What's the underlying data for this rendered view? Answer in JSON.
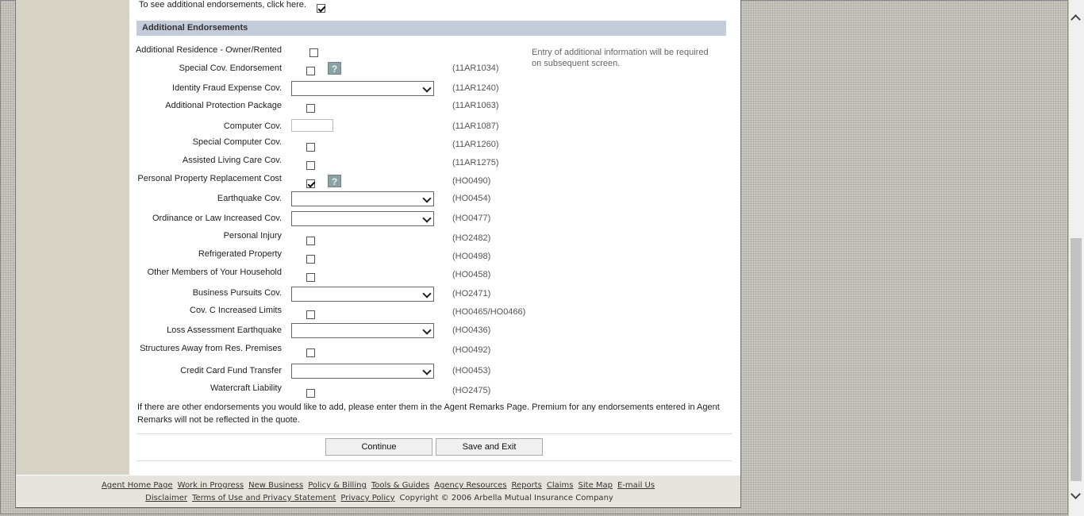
{
  "intro_text": "To see additional endorsements, click here.",
  "section_title": "Additional Endorsements",
  "note": "Entry of additional information will be required on subsequent screen.",
  "rows": [
    {
      "label": "Additional Residence - Owner/Rented",
      "code": "",
      "control": "checkbox",
      "checked": false
    },
    {
      "label": "Special Cov. Endorsement",
      "code": "(11AR1034)",
      "control": "checkbox",
      "checked": false,
      "help": "?"
    },
    {
      "label": "Identity Fraud Expense Cov.",
      "code": "(11AR1240)",
      "control": "select",
      "value": ""
    },
    {
      "label": "Additional Protection Package",
      "code": "(11AR1063)",
      "control": "checkbox",
      "checked": false
    },
    {
      "label": "Computer Cov.",
      "code": "(11AR1087)",
      "control": "text",
      "value": ""
    },
    {
      "label": "Special Computer Cov.",
      "code": "(11AR1260)",
      "control": "checkbox",
      "checked": false
    },
    {
      "label": "Assisted Living Care Cov.",
      "code": "(11AR1275)",
      "control": "checkbox",
      "checked": false
    },
    {
      "label": "Personal Property Replacement Cost",
      "code": "(HO0490)",
      "control": "checkbox",
      "checked": true,
      "help": "?"
    },
    {
      "label": "Earthquake Cov.",
      "code": "(HO0454)",
      "control": "select",
      "value": ""
    },
    {
      "label": "Ordinance or Law Increased Cov.",
      "code": "(HO0477)",
      "control": "select",
      "value": ""
    },
    {
      "label": "Personal Injury",
      "code": "(HO2482)",
      "control": "checkbox",
      "checked": false
    },
    {
      "label": "Refrigerated Property",
      "code": "(HO0498)",
      "control": "checkbox",
      "checked": false
    },
    {
      "label": "Other Members of Your Household",
      "code": "(HO0458)",
      "control": "checkbox",
      "checked": false
    },
    {
      "label": "Business Pursuits Cov.",
      "code": "(HO2471)",
      "control": "select",
      "value": ""
    },
    {
      "label": "Cov. C Increased Limits",
      "code": "(HO0465/HO0466)",
      "control": "checkbox",
      "checked": false
    },
    {
      "label": "Loss Assessment Earthquake",
      "code": "(HO0436)",
      "control": "select",
      "value": ""
    },
    {
      "label": "Structures Away from Res. Premises",
      "code": "(HO0492)",
      "control": "checkbox",
      "checked": false
    },
    {
      "label": "Credit Card Fund Transfer",
      "code": "(HO0453)",
      "control": "select",
      "value": ""
    },
    {
      "label": "Watercraft Liability",
      "code": "(HO2475)",
      "control": "checkbox",
      "checked": false
    }
  ],
  "remarks": "If there are other endorsements you would like to add, please enter them in the Agent Remarks Page. Premium for any endorsements entered in Agent Remarks will not be reflected in the quote.",
  "buttons": {
    "continue": "Continue",
    "save_exit": "Save and Exit"
  },
  "footer": {
    "links_row1": [
      "Agent Home Page",
      "Work in Progress",
      "New Business",
      "Policy & Billing",
      "Tools & Guides",
      "Agency Resources",
      "Reports",
      "Claims",
      "Site Map",
      "E-mail Us"
    ],
    "links_row2": [
      "Disclaimer",
      "Terms of Use and Privacy Statement",
      "Privacy Policy"
    ],
    "copyright": "Copyright © 2006 Arbella Mutual Insurance Company"
  }
}
